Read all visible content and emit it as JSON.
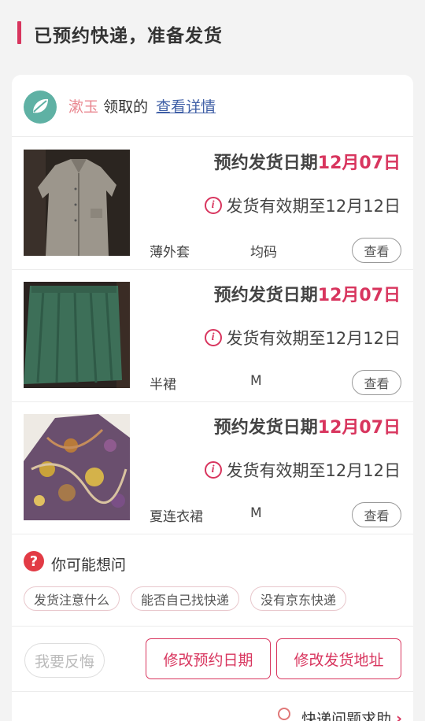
{
  "header": {
    "title": "已预约快递，准备发货"
  },
  "giver": {
    "name": "漱玉",
    "action": "领取的",
    "link": "查看详情"
  },
  "items": [
    {
      "ship_label": "预约发货日期",
      "ship_date": "12月07日",
      "validity": "发货有效期至12月12日",
      "name": "薄外套",
      "size": "均码",
      "button": "查看"
    },
    {
      "ship_label": "预约发货日期",
      "ship_date": "12月07日",
      "validity": "发货有效期至12月12日",
      "name": "半裙",
      "size": "M",
      "button": "查看"
    },
    {
      "ship_label": "预约发货日期",
      "ship_date": "12月07日",
      "validity": "发货有效期至12月12日",
      "name": "夏连衣裙",
      "size": "M",
      "button": "查看"
    }
  ],
  "faq": {
    "title": "你可能想问",
    "chips": [
      "发货注意什么",
      "能否自己找快递",
      "没有京东快递"
    ]
  },
  "actions": {
    "regret": "我要反悔",
    "change_date": "修改预约日期",
    "change_address": "修改发货地址"
  },
  "help": {
    "label": "快递问题求助"
  },
  "colors": {
    "accent": "#d8355e",
    "giver_name": "#e9868f",
    "link": "#3f5fa6"
  },
  "icons": [
    "leaf-logo-icon",
    "info-icon",
    "question-icon",
    "location-pin-icon",
    "chevron-right-icon"
  ]
}
